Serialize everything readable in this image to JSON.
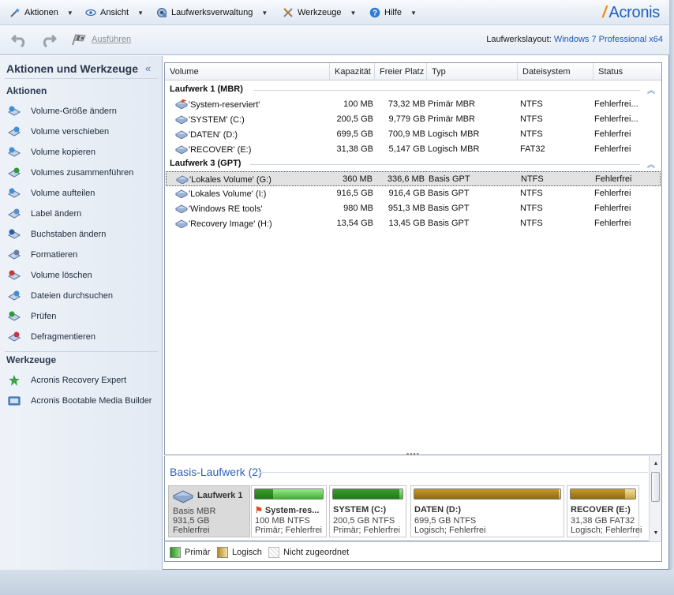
{
  "menu": {
    "actions": "Aktionen",
    "view": "Ansicht",
    "disk_management": "Laufwerksverwaltung",
    "tools": "Werkzeuge",
    "help": "Hilfe",
    "logo": "Acronis"
  },
  "toolbar": {
    "execute": "Ausführen",
    "layout_label": "Laufwerkslayout:",
    "layout_value": "Windows 7 Professional x64"
  },
  "sidebar": {
    "title": "Aktionen und Werkzeuge",
    "collapse": "«",
    "actions_heading": "Aktionen",
    "actions": [
      {
        "label": "Volume-Größe ändern",
        "icon": "resize-volume-icon"
      },
      {
        "label": "Volume verschieben",
        "icon": "move-volume-icon"
      },
      {
        "label": "Volume kopieren",
        "icon": "copy-volume-icon"
      },
      {
        "label": "Volumes zusammenführen",
        "icon": "merge-volumes-icon"
      },
      {
        "label": "Volume aufteilen",
        "icon": "split-volume-icon"
      },
      {
        "label": "Label ändern",
        "icon": "label-icon"
      },
      {
        "label": "Buchstaben ändern",
        "icon": "letter-icon"
      },
      {
        "label": "Formatieren",
        "icon": "format-icon"
      },
      {
        "label": "Volume löschen",
        "icon": "delete-volume-icon"
      },
      {
        "label": "Dateien durchsuchen",
        "icon": "browse-files-icon"
      },
      {
        "label": "Prüfen",
        "icon": "check-icon"
      },
      {
        "label": "Defragmentieren",
        "icon": "defragment-icon"
      }
    ],
    "tools_heading": "Werkzeuge",
    "tools": [
      {
        "label": "Acronis Recovery Expert",
        "icon": "recovery-expert-icon"
      },
      {
        "label": "Acronis Bootable Media Builder",
        "icon": "media-builder-icon"
      }
    ]
  },
  "table": {
    "columns": [
      "Volume",
      "Kapazität",
      "Freier Platz",
      "Typ",
      "Dateisystem",
      "Status"
    ],
    "groups": [
      {
        "name": "Laufwerk 1 (MBR)",
        "rows": [
          {
            "volume": "'System-reserviert'",
            "capacity": "100 MB",
            "free": "73,32 MB",
            "type": "Primär MBR",
            "fs": "NTFS",
            "status": "Fehlerfrei..."
          },
          {
            "volume": "'SYSTEM' (C:)",
            "capacity": "200,5 GB",
            "free": "9,779 GB",
            "type": "Primär MBR",
            "fs": "NTFS",
            "status": "Fehlerfrei..."
          },
          {
            "volume": "'DATEN' (D:)",
            "capacity": "699,5 GB",
            "free": "700,9 MB",
            "type": "Logisch MBR",
            "fs": "NTFS",
            "status": "Fehlerfrei"
          },
          {
            "volume": "'RECOVER' (E:)",
            "capacity": "31,38 GB",
            "free": "5,147 GB",
            "type": "Logisch MBR",
            "fs": "FAT32",
            "status": "Fehlerfrei"
          }
        ]
      },
      {
        "name": "Laufwerk 3 (GPT)",
        "rows": [
          {
            "volume": "'Lokales Volume' (G:)",
            "capacity": "360 MB",
            "free": "336,6 MB",
            "type": "Basis GPT",
            "fs": "NTFS",
            "status": "Fehlerfrei"
          },
          {
            "volume": "'Lokales Volume' (I:)",
            "capacity": "916,5 GB",
            "free": "916,4 GB",
            "type": "Basis GPT",
            "fs": "NTFS",
            "status": "Fehlerfrei"
          },
          {
            "volume": "'Windows RE tools'",
            "capacity": "980 MB",
            "free": "951,3 MB",
            "type": "Basis GPT",
            "fs": "NTFS",
            "status": "Fehlerfrei"
          },
          {
            "volume": "'Recovery Image' (H:)",
            "capacity": "13,54 GB",
            "free": "13,45 GB",
            "type": "Basis GPT",
            "fs": "NTFS",
            "status": "Fehlerfrei"
          }
        ]
      }
    ]
  },
  "lower": {
    "title": "Basis-Laufwerk (2)",
    "disk": {
      "name": "Laufwerk 1",
      "l1": "Basis MBR",
      "l2": "931,5 GB",
      "l3": "Fehlerfrei"
    },
    "partitions": [
      {
        "name": "System-res...",
        "l1": "100 MB NTFS",
        "l2": "Primär; Fehlerfrei",
        "used": 0.27,
        "kind": "primary"
      },
      {
        "name": "SYSTEM (C:)",
        "l1": "200,5 GB NTFS",
        "l2": "Primär; Fehlerfrei",
        "used": 0.95,
        "kind": "primary"
      },
      {
        "name": "DATEN (D:)",
        "l1": "699,5 GB NTFS",
        "l2": "Logisch; Fehlerfrei",
        "used": 0.99,
        "kind": "logical"
      },
      {
        "name": "RECOVER (E:)",
        "l1": "31,38 GB FAT32",
        "l2": "Logisch; Fehlerfrei",
        "used": 0.84,
        "kind": "logical"
      }
    ]
  },
  "legend": {
    "primary": "Primär",
    "logical": "Logisch",
    "unallocated": "Nicht zugeordnet"
  },
  "colors": {
    "accent": "#1d5fbf",
    "primary": "#3fb332",
    "logical": "#c9a53e"
  }
}
